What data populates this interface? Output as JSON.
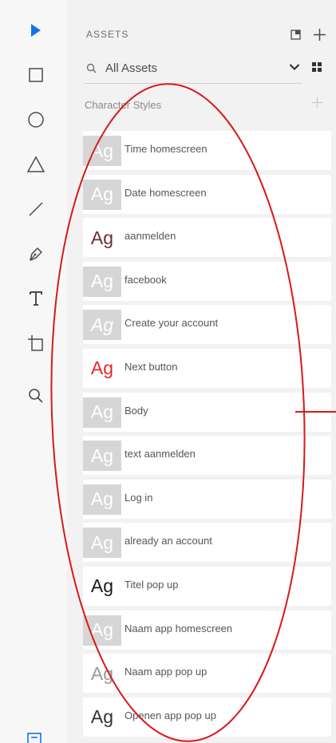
{
  "panel": {
    "title": "ASSETS",
    "search": {
      "value": "All Assets"
    },
    "section": {
      "label": "Character Styles"
    }
  },
  "character_styles": [
    {
      "label": "Time homescreen",
      "preview": "Ag",
      "style": "grey",
      "color": "#ffffff"
    },
    {
      "label": "Date homescreen",
      "preview": "Ag",
      "style": "grey",
      "color": "#ffffff"
    },
    {
      "label": "aanmelden",
      "preview": "Ag",
      "style": "plain",
      "color": "#6b2f2f"
    },
    {
      "label": "facebook",
      "preview": "Ag",
      "style": "grey",
      "color": "#ffffff"
    },
    {
      "label": "Create your account",
      "preview": "Ag",
      "style": "grey italic",
      "color": "#ffffff"
    },
    {
      "label": "Next button",
      "preview": "Ag",
      "style": "plain",
      "color": "#e8262c"
    },
    {
      "label": "Body",
      "preview": "Ag",
      "style": "grey",
      "color": "#ffffff"
    },
    {
      "label": "text aanmelden",
      "preview": "Ag",
      "style": "grey",
      "color": "#ffffff"
    },
    {
      "label": "Log in",
      "preview": "Ag",
      "style": "grey",
      "color": "#ffffff"
    },
    {
      "label": "already an account",
      "preview": "Ag",
      "style": "grey",
      "color": "#ffffff"
    },
    {
      "label": "Titel pop up",
      "preview": "Ag",
      "style": "plain",
      "color": "#1a1a1a"
    },
    {
      "label": "Naam app homescreen",
      "preview": "Ag",
      "style": "grey",
      "color": "#ffffff"
    },
    {
      "label": "Naam app pop up",
      "preview": "Ag",
      "style": "plain thin",
      "color": "#9a9a9a"
    },
    {
      "label": "Openen app pop up",
      "preview": "Ag",
      "style": "plain",
      "color": "#333333"
    }
  ],
  "colors": {
    "accent": "#1473e6",
    "annotation": "#d7191c",
    "icon": "#4b4b4b"
  },
  "icons": {
    "tools": [
      "select-arrow-icon",
      "rectangle-icon",
      "ellipse-icon",
      "triangle-icon",
      "line-icon",
      "pen-icon",
      "text-icon",
      "artboard-icon",
      "zoom-icon"
    ],
    "header": [
      "open-library-icon",
      "add-icon"
    ],
    "search": "search-icon",
    "filter": "chevron-down-icon",
    "view": "grid-view-icon"
  }
}
